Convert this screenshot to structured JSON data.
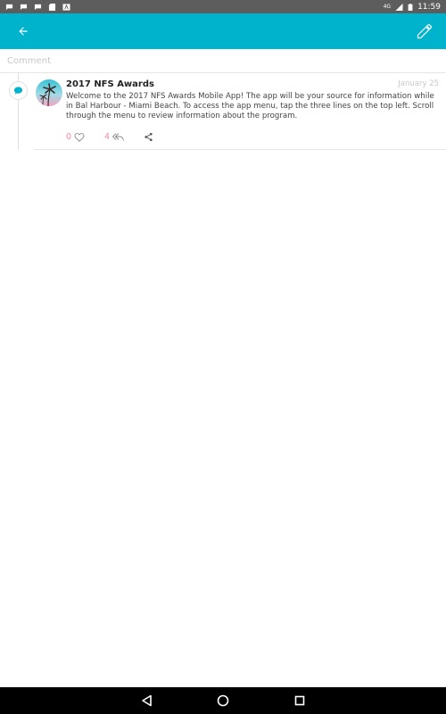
{
  "status_bar": {
    "notification_icons": [
      "chat-icon",
      "chat-icon",
      "chat-icon",
      "sd-card-icon",
      "app-icon"
    ],
    "network": "4G",
    "time": "11:59"
  },
  "app_bar": {
    "back_icon": "arrow-back-icon",
    "edit_icon": "pencil-icon",
    "color": "#00b3cc"
  },
  "comment": {
    "placeholder": "Comment"
  },
  "post": {
    "author": "2017 NFS Awards",
    "date": "January 25",
    "body": "Welcome to the 2017 NFS Awards Mobile App! The app will be your source for information while in Bal Harbour - Miami Beach. To access the app menu, tap the three lines on the top left. Scroll through the menu to review information about the program.",
    "likes": "0",
    "replies": "4"
  },
  "nav_bar": {
    "buttons": [
      "back-triangle-icon",
      "home-circle-icon",
      "recents-square-icon"
    ]
  }
}
